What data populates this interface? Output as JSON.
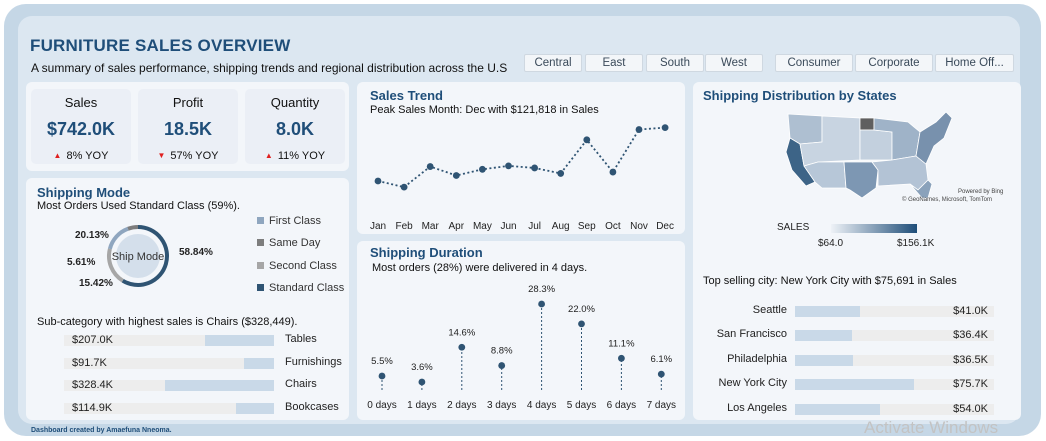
{
  "header": {
    "title": "FURNITURE SALES OVERVIEW",
    "subtitle": "A summary of sales performance, shipping trends and regional distribution across the U.S"
  },
  "slicers": {
    "regions": [
      "Central",
      "East",
      "South",
      "West"
    ],
    "segments": [
      "Consumer",
      "Corporate",
      "Home Off..."
    ]
  },
  "kpis": {
    "sales": {
      "label": "Sales",
      "value": "$742.0K",
      "yoy": "8% YOY",
      "direction": "up"
    },
    "profit": {
      "label": "Profit",
      "value": "18.5K",
      "yoy": "57% YOY",
      "direction": "down"
    },
    "quantity": {
      "label": "Quantity",
      "value": "8.0K",
      "yoy": "11% YOY",
      "direction": "up"
    }
  },
  "colors": {
    "brand": "#1f4e79",
    "accent_dark": "#2f5473",
    "bar_fill": "#c9d9e8",
    "up": "#e02020",
    "down": "#e02020"
  },
  "shipping_mode": {
    "title": "Shipping Mode",
    "note": "Most Orders Used Standard Class (59%).",
    "center_label": "Ship Mode",
    "slice_labels": [
      "58.84%",
      "20.13%",
      "5.61%",
      "15.42%"
    ],
    "legend": [
      {
        "label": "First Class",
        "color": "#8fa6bf"
      },
      {
        "label": "Same Day",
        "color": "#7d7d7d"
      },
      {
        "label": "Second Class",
        "color": "#a6a6a6"
      },
      {
        "label": "Standard Class",
        "color": "#2f5473"
      }
    ]
  },
  "subcategory": {
    "note": "Sub-category with highest sales is Chairs ($328,449).",
    "items": [
      {
        "name": "Tables",
        "label": "$207.0K",
        "value": 207.0
      },
      {
        "name": "Furnishings",
        "label": "$91.7K",
        "value": 91.7
      },
      {
        "name": "Chairs",
        "label": "$328.4K",
        "value": 328.4
      },
      {
        "name": "Bookcases",
        "label": "$114.9K",
        "value": 114.9
      }
    ]
  },
  "sales_trend": {
    "title": "Sales Trend",
    "note": "Peak Sales Month: Dec with $121,818 in Sales"
  },
  "shipping_duration": {
    "title": "Shipping Duration",
    "note": "Most orders (28%) were delivered in 4 days."
  },
  "map": {
    "title": "Shipping Distribution by States",
    "attribution_1": "Powered by Bing",
    "attribution_2": "© GeoNames, Microsoft, TomTom",
    "legend_title": "SALES",
    "legend_min": "$64.0",
    "legend_max": "$156.1K"
  },
  "cities": {
    "note": "Top selling city: New York City with $75,691 in Sales",
    "items": [
      {
        "name": "Seattle",
        "label": "$41.0K",
        "value": 41.0
      },
      {
        "name": "San Francisco",
        "label": "$36.4K",
        "value": 36.4
      },
      {
        "name": "Philadelphia",
        "label": "$36.5K",
        "value": 36.5
      },
      {
        "name": "New York City",
        "label": "$75.7K",
        "value": 75.7
      },
      {
        "name": "Los Angeles",
        "label": "$54.0K",
        "value": 54.0
      }
    ]
  },
  "footer": {
    "credit": "Dashboard created by Amaefuna Nneoma."
  },
  "watermark": {
    "text": "Activate Windows"
  },
  "chart_data": [
    {
      "type": "line",
      "title": "Sales Trend",
      "categories": [
        "Jan",
        "Feb",
        "Mar",
        "Apr",
        "May",
        "Jun",
        "Jul",
        "Aug",
        "Sep",
        "Oct",
        "Nov",
        "Dec"
      ],
      "values": [
        44000,
        35000,
        65000,
        52000,
        61000,
        66000,
        63000,
        55000,
        104000,
        57000,
        119000,
        121818
      ],
      "ylim": [
        25000,
        130000
      ],
      "grid": false
    },
    {
      "type": "scatter",
      "title": "Shipping Duration",
      "categories": [
        "0 days",
        "1 days",
        "2 days",
        "3 days",
        "4 days",
        "5 days",
        "6 days",
        "7 days"
      ],
      "values": [
        5.5,
        3.6,
        14.6,
        8.8,
        28.3,
        22.0,
        11.1,
        6.1
      ],
      "labels": [
        "5.5%",
        "3.6%",
        "14.6%",
        "8.8%",
        "28.3%",
        "22.0%",
        "11.1%",
        "6.1%"
      ],
      "ylim": [
        0,
        30
      ]
    },
    {
      "type": "pie",
      "title": "Ship Mode",
      "categories": [
        "Standard Class",
        "Second Class",
        "First Class",
        "Same Day"
      ],
      "values": [
        58.84,
        20.13,
        15.42,
        5.61
      ]
    },
    {
      "type": "bar",
      "categories": [
        "Tables",
        "Furnishings",
        "Chairs",
        "Bookcases"
      ],
      "values": [
        207.0,
        91.7,
        328.4,
        114.9
      ]
    },
    {
      "type": "bar",
      "categories": [
        "Seattle",
        "San Francisco",
        "Philadelphia",
        "New York City",
        "Los Angeles"
      ],
      "values": [
        41.0,
        36.4,
        36.5,
        75.7,
        54.0
      ]
    }
  ]
}
